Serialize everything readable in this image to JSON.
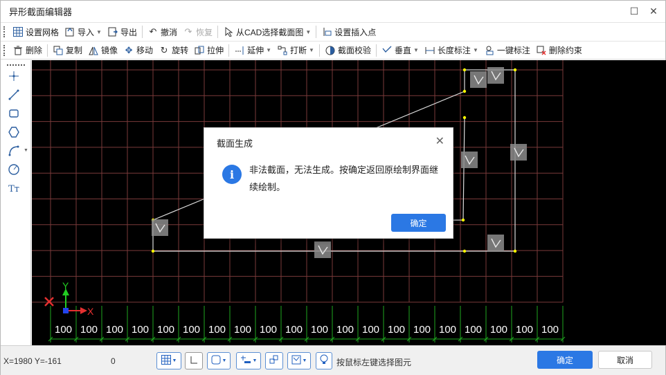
{
  "window": {
    "title": "异形截面编辑器",
    "maximize_glyph": "☐",
    "close_glyph": "✕"
  },
  "toolbar1": [
    {
      "label": "设置网格",
      "icon": "grid-icon"
    },
    {
      "label": "导入",
      "icon": "import-icon",
      "dropdown": true
    },
    {
      "label": "导出",
      "icon": "export-icon"
    },
    {
      "label": "撤消",
      "icon": "undo-icon"
    },
    {
      "label": "恢复",
      "icon": "redo-icon",
      "disabled": true
    },
    {
      "label": "从CAD选择截面图",
      "icon": "cad-select-icon",
      "dropdown": true
    },
    {
      "label": "设置插入点",
      "icon": "insert-point-icon"
    }
  ],
  "toolbar2": [
    {
      "label": "删除",
      "icon": "trash-icon"
    },
    {
      "label": "复制",
      "icon": "copy-icon"
    },
    {
      "label": "镜像",
      "icon": "mirror-icon"
    },
    {
      "label": "移动",
      "icon": "move-icon"
    },
    {
      "label": "旋转",
      "icon": "rotate-icon"
    },
    {
      "label": "拉伸",
      "icon": "stretch-icon"
    },
    {
      "label": "延伸",
      "icon": "extend-icon",
      "dropdown": true
    },
    {
      "label": "打断",
      "icon": "break-icon",
      "dropdown": true
    },
    {
      "label": "截面校验",
      "icon": "section-check-icon"
    },
    {
      "label": "垂直",
      "icon": "perpendicular-icon",
      "dropdown": true
    },
    {
      "label": "长度标注",
      "icon": "length-dimension-icon",
      "dropdown": true
    },
    {
      "label": "一键标注",
      "icon": "auto-dimension-icon"
    },
    {
      "label": "删除约束",
      "icon": "delete-constraint-icon"
    }
  ],
  "left_tools": [
    "point-icon",
    "line-icon",
    "rectangle-icon",
    "polygon-icon",
    "arc-icon",
    "circle-icon",
    "text-icon"
  ],
  "canvas": {
    "grid_label": "100",
    "grid_label_count": 20,
    "axis_x": "X",
    "axis_y": "Y",
    "colors": {
      "grid": "#7a3a3a",
      "shape": "#ffffff",
      "vertex": "#ffff00",
      "dimension": "#1fa81f",
      "axis_x": "#e53030",
      "axis_y": "#22cc22"
    }
  },
  "dialog": {
    "title": "截面生成",
    "message": "非法截面，无法生成。按确定返回原绘制界面继续绘制。",
    "ok_label": "确定",
    "close_glyph": "✕",
    "info_glyph": "i"
  },
  "status": {
    "coords": "X=1980 Y=-161",
    "value": "0",
    "hint": "按鼠标左键选择图元",
    "ok_label": "确定",
    "cancel_label": "取消"
  }
}
